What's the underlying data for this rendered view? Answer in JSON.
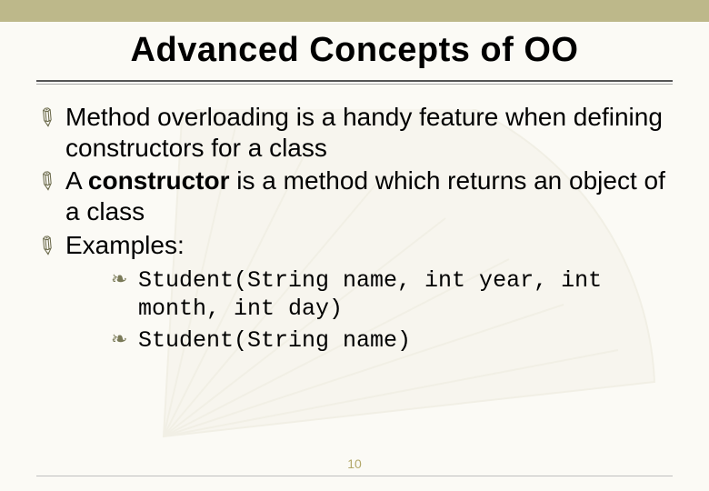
{
  "title": "Advanced Concepts of OO",
  "bullets": [
    {
      "text_before": "Method overloading is a handy feature when defining constructors for a class",
      "bold": "",
      "text_after": ""
    },
    {
      "text_before": "A ",
      "bold": "constructor",
      "text_after": " is a method which returns an object of a class"
    },
    {
      "text_before": "Examples:",
      "bold": "",
      "text_after": ""
    }
  ],
  "sub_bullets": [
    "Student(String name, int year, int month, int day)",
    "Student(String name)"
  ],
  "page_number": "10"
}
